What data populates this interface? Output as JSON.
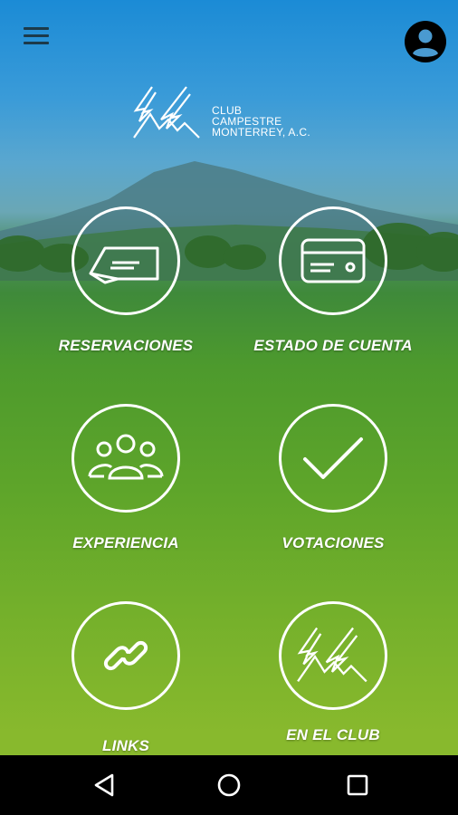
{
  "header": {
    "menu_icon": "hamburger-menu-icon",
    "account_icon": "account-circle-icon"
  },
  "logo": {
    "line1": "CLUB",
    "line2": "CAMPESTRE",
    "line3": "MONTERREY, A.C."
  },
  "tiles": [
    {
      "label": "RESERVACIONES",
      "icon": "reservation-ticket-icon"
    },
    {
      "label": "ESTADO DE CUENTA",
      "icon": "credit-card-icon"
    },
    {
      "label": "EXPERIENCIA",
      "icon": "people-group-icon"
    },
    {
      "label": "VOTACIONES",
      "icon": "checkmark-icon"
    },
    {
      "label": "LINKS",
      "icon": "link-chain-icon"
    },
    {
      "label": "EN EL CLUB",
      "icon": "club-logo-icon"
    }
  ],
  "navbar": {
    "back_icon": "back-triangle-icon",
    "home_icon": "home-circle-icon",
    "recents_icon": "recents-square-icon"
  },
  "colors": {
    "accent_white": "#ffffff",
    "nav_background": "#000000",
    "sky": "#1b8bd6",
    "grass": "#5ea52a"
  }
}
